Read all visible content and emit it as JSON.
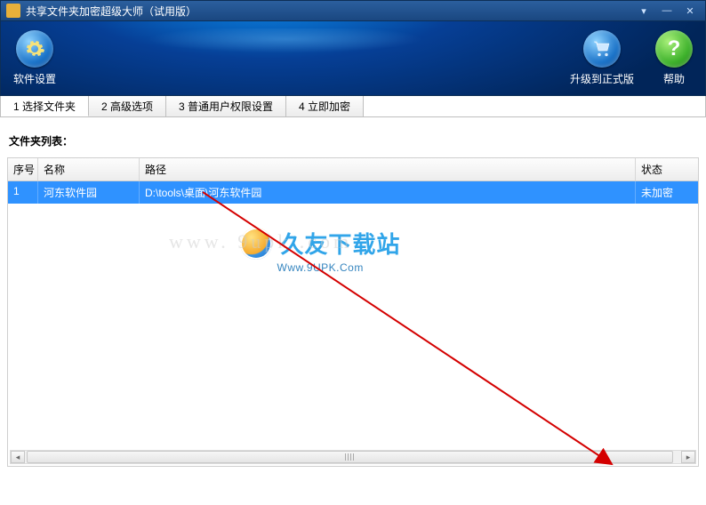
{
  "window": {
    "title": "共享文件夹加密超级大师（试用版）"
  },
  "header": {
    "settings": "软件设置",
    "upgrade": "升级到正式版",
    "help": "帮助"
  },
  "tabs": {
    "t1": "1 选择文件夹",
    "t2": "2 高级选项",
    "t3": "3 普通用户权限设置",
    "t4": "4 立即加密"
  },
  "labels": {
    "folder_list": "文件夹列表："
  },
  "columns": {
    "index": "序号",
    "name": "名称",
    "path": "路径",
    "status": "状态"
  },
  "rows": [
    {
      "index": "1",
      "name": "河东软件园",
      "path": "D:\\tools\\桌面\\河东软件园",
      "status": "未加密"
    }
  ],
  "watermark": {
    "text": "久友下载站",
    "sub": "Www.9UPK.Com",
    "ghost": "www. 9upk .com"
  }
}
